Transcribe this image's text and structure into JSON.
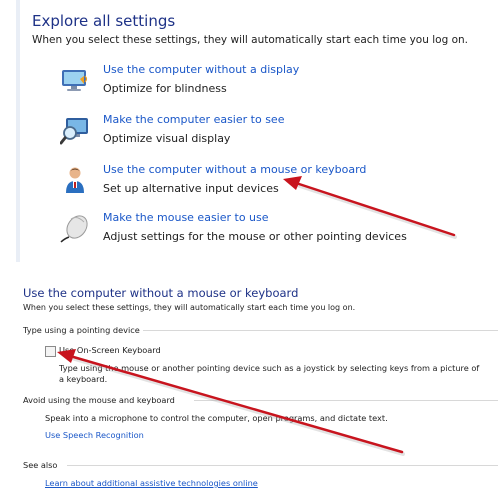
{
  "explore": {
    "title": "Explore all settings",
    "subtitle": "When you select these settings, they will automatically start each time you log on.",
    "items": [
      {
        "link": "Use the computer without a display",
        "desc": "Optimize for blindness",
        "icon": "monitor-speaker-icon"
      },
      {
        "link": "Make the computer easier to see",
        "desc": "Optimize visual display",
        "icon": "magnifier-monitor-icon"
      },
      {
        "link": "Use the computer without a mouse or keyboard",
        "desc": "Set up alternative input devices",
        "icon": "person-icon"
      },
      {
        "link": "Make the mouse easier to use",
        "desc": "Adjust settings for the mouse or other pointing devices",
        "icon": "mouse-icon"
      }
    ]
  },
  "detail": {
    "title": "Use the computer without a mouse or keyboard",
    "subtitle": "When you select these settings, they will automatically start each time you log on.",
    "pointing": {
      "heading": "Type using a pointing device",
      "checkbox_label": "Use On-Screen Keyboard",
      "checkbox_checked": false,
      "help_line1": "Type using the mouse or another pointing device such as a joystick by selecting keys from a picture of",
      "help_line2": "a keyboard."
    },
    "avoid": {
      "heading": "Avoid using the mouse and keyboard",
      "text": "Speak into a microphone to control the computer, open programs, and dictate text.",
      "link": "Use Speech Recognition"
    },
    "see_also": {
      "heading": "See also",
      "link": "Learn about additional assistive technologies online"
    }
  },
  "colors": {
    "link": "#1a57c8",
    "heading": "#1e3287",
    "annotation_arrow": "#c8141e"
  }
}
